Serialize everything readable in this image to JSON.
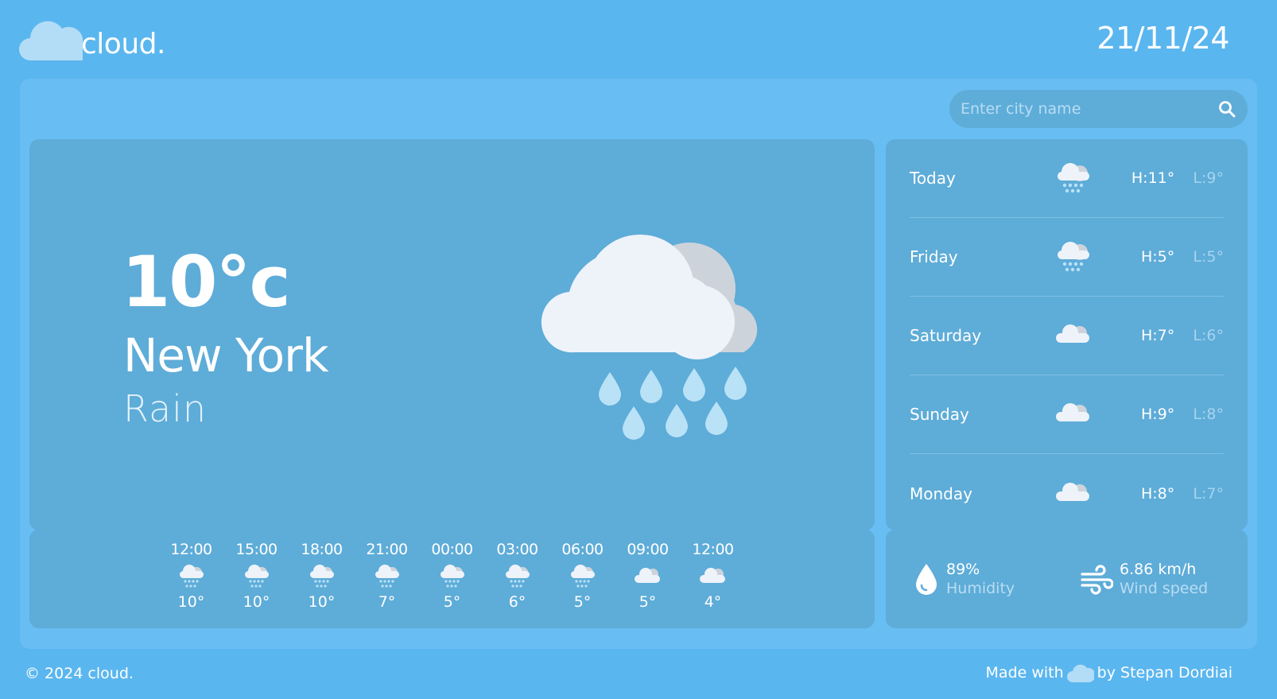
{
  "header": {
    "logo_text": "cloud.",
    "date": "21/11/24"
  },
  "search": {
    "placeholder": "Enter city name"
  },
  "current": {
    "temperature": "10°c",
    "city": "New York",
    "condition": "Rain",
    "icon": "rain-cloud-icon"
  },
  "daily": [
    {
      "day": "Today",
      "icon": "rain-cloud-icon",
      "high": "H:11°",
      "low": "L:9°"
    },
    {
      "day": "Friday",
      "icon": "rain-cloud-icon",
      "high": "H:5°",
      "low": "L:5°"
    },
    {
      "day": "Saturday",
      "icon": "cloudy-icon",
      "high": "H:7°",
      "low": "L:6°"
    },
    {
      "day": "Sunday",
      "icon": "cloudy-icon",
      "high": "H:9°",
      "low": "L:8°"
    },
    {
      "day": "Monday",
      "icon": "cloudy-icon",
      "high": "H:8°",
      "low": "L:7°"
    }
  ],
  "hourly": [
    {
      "time": "12:00",
      "icon": "rain-cloud-icon",
      "temp": "10°"
    },
    {
      "time": "15:00",
      "icon": "rain-cloud-icon",
      "temp": "10°"
    },
    {
      "time": "18:00",
      "icon": "rain-cloud-icon",
      "temp": "10°"
    },
    {
      "time": "21:00",
      "icon": "rain-cloud-icon",
      "temp": "7°"
    },
    {
      "time": "00:00",
      "icon": "rain-cloud-icon",
      "temp": "5°"
    },
    {
      "time": "03:00",
      "icon": "rain-cloud-icon",
      "temp": "6°"
    },
    {
      "time": "06:00",
      "icon": "rain-cloud-icon",
      "temp": "5°"
    },
    {
      "time": "09:00",
      "icon": "cloudy-icon",
      "temp": "5°"
    },
    {
      "time": "12:00",
      "icon": "cloudy-icon",
      "temp": "4°"
    }
  ],
  "stats": {
    "humidity": {
      "value": "89%",
      "label": "Humidity",
      "icon": "water-drop-icon"
    },
    "wind": {
      "value": "6.86 km/h",
      "label": "Wind speed",
      "icon": "wind-icon"
    }
  },
  "footer": {
    "copyright": "© 2024 cloud.",
    "made_with": "Made with",
    "by": "by Stepan Dordiai"
  },
  "colors": {
    "background": "#5ab6ef",
    "panel": "#68bdf3",
    "card": "#5eacd8",
    "cloud_front": "#eef3fa",
    "cloud_back": "#cdd3da",
    "rain": "#b9e2f7"
  }
}
